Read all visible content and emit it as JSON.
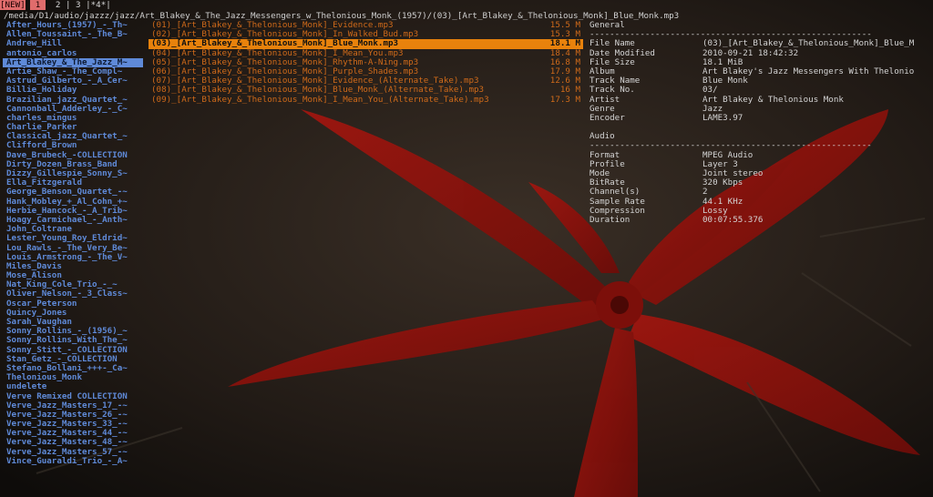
{
  "tabs": [
    {
      "label": "[NEW]",
      "style": "new"
    },
    {
      "label": " 1 ",
      "style": "active"
    },
    {
      "label": " 2 | 3 |*4*|",
      "style": "normal"
    }
  ],
  "path": "/media/D1/audio/jazzz/jazz/Art_Blakey_&_The_Jazz_Messengers_w_Thelonious_Monk_(1957)/(03)_[Art_Blakey_&_Thelonious_Monk]_Blue_Monk.mp3",
  "directories": [
    "After_Hours_(1957)_-_Th~",
    "Allen_Toussaint_-_The_B~",
    "Andrew_Hill",
    "antonio_carlos",
    "Art_Blakey_&_The_Jazz_M~",
    "Artie_Shaw_-_The_Compl~",
    "Astrud_Gilberto_-_A_Cer~",
    "Billie_Holiday",
    "Brazilian_jazz_Quartet_~",
    "Cannonball_Adderley_-_C~",
    "charles_mingus",
    "Charlie_Parker",
    "Classical_jazz_Quartet_~",
    "Clifford_Brown",
    "Dave_Brubeck_-COLLECTION",
    "Dirty_Dozen_Brass_Band",
    "Dizzy_Gillespie_Sonny_S~",
    "Ella_Fitzgerald",
    "George_Benson_Quartet_-~",
    "Hank_Mobley_+_Al_Cohn_+~",
    "Herbie_Hancock_-_A_Trib~",
    "Hoagy_Carmichael_-_Anth~",
    "John_Coltrane",
    "Lester_Young_Roy_Eldrid~",
    "Lou_Rawls_-_The_Very_Be~",
    "Louis_Armstrong_-_The_V~",
    "Miles_Davis",
    "Mose_Alison",
    "Nat_King_Cole_Trio_-_~",
    "Oliver_Nelson_-_3_Class~",
    "Oscar_Peterson",
    "Quincy_Jones",
    "Sarah_Vaughan",
    "Sonny_Rollins_-_(1956)_~",
    "Sonny_Rollins_With_The_~",
    "Sonny_Stitt_-_COLLECTION",
    "Stan_Getz_-_COLLECTION",
    "Stefano_Bollani_+++-_Ca~",
    "Thelonious_Monk",
    "undelete",
    "Verve Remixed COLLECTION",
    "Verve_Jazz_Masters_17_-~",
    "Verve_Jazz_Masters_26_-~",
    "Verve_Jazz_Masters_33_-~",
    "Verve_Jazz_Masters_44_-~",
    "Verve_Jazz_Masters_48_-~",
    "Verve_Jazz_Masters_57_-~",
    "Vince_Guaraldi_Trio_-_A~"
  ],
  "selected_directory_index": 4,
  "files": [
    {
      "name": "(01)_[Art_Blakey_&_Thelonious_Monk]_Evidence.mp3",
      "size": "15.5 M"
    },
    {
      "name": "(02)_[Art_Blakey_&_Thelonious_Monk]_In_Walked_Bud.mp3",
      "size": "15.3 M"
    },
    {
      "name": "(03)_[Art_Blakey_&_Thelonious_Monk]_Blue_Monk.mp3",
      "size": "18.1 M"
    },
    {
      "name": "(04)_[Art_Blakey_&_Thelonious_Monk]_I_Mean_You.mp3",
      "size": "18.4 M"
    },
    {
      "name": "(05)_[Art_Blakey_&_Thelonious_Monk]_Rhythm-A-Ning.mp3",
      "size": "16.8 M"
    },
    {
      "name": "(06)_[Art_Blakey_&_Thelonious_Monk]_Purple_Shades.mp3",
      "size": "17.9 M"
    },
    {
      "name": "(07)_[Art_Blakey_&_Thelonious_Monk]_Evidence_(Alternate_Take).mp3",
      "size": "12.6 M"
    },
    {
      "name": "(08)_[Art_Blakey_&_Thelonious_Monk]_Blue_Monk_(Alternate_Take).mp3",
      "size": "16 M"
    },
    {
      "name": "(09)_[Art_Blakey_&_Thelonious_Monk]_I_Mean_You_(Alternate_Take).mp3",
      "size": "17.3 M"
    }
  ],
  "selected_file_index": 2,
  "info": {
    "general_header": "General",
    "separator": "--------------------------------------------------------",
    "general": [
      {
        "k": "File Name",
        "v": "(03)_[Art_Blakey_&_Thelonious_Monk]_Blue_M"
      },
      {
        "k": "Date Modified",
        "v": "2010-09-21 18:42:32"
      },
      {
        "k": "File Size",
        "v": "18.1 MiB"
      },
      {
        "k": "Album",
        "v": "Art Blakey's Jazz Messengers With Thelonio"
      },
      {
        "k": "Track Name",
        "v": "Blue Monk"
      },
      {
        "k": "Track No.",
        "v": "03/"
      },
      {
        "k": "Artist",
        "v": "Art Blakey & Thelonious Monk"
      },
      {
        "k": "Genre",
        "v": "Jazz"
      },
      {
        "k": "Encoder",
        "v": "LAME3.97"
      }
    ],
    "audio_header": "Audio",
    "audio": [
      {
        "k": "Format",
        "v": "MPEG Audio"
      },
      {
        "k": "Profile",
        "v": "Layer 3"
      },
      {
        "k": "Mode",
        "v": "Joint stereo"
      },
      {
        "k": "BitRate",
        "v": "320 Kbps"
      },
      {
        "k": "Channel(s)",
        "v": "2"
      },
      {
        "k": "Sample Rate",
        "v": "44.1 KHz"
      },
      {
        "k": "Compression",
        "v": "Lossy"
      },
      {
        "k": "Duration",
        "v": "00:07:55.376"
      }
    ]
  }
}
